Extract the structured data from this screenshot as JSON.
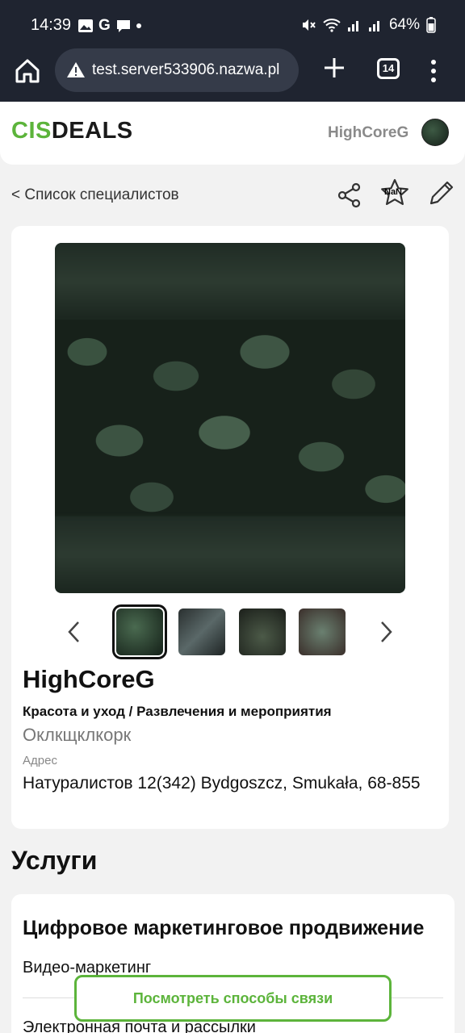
{
  "status_bar": {
    "time": "14:39",
    "battery": "64%"
  },
  "browser": {
    "url": "test.server533906.nazwa.pl",
    "tab_count": "14"
  },
  "header": {
    "logo_part1": "CIS",
    "logo_part2": "DEALS",
    "username": "HighCoreG"
  },
  "breadcrumb": {
    "back_label": "< Список специалистов",
    "rating_text": "NaN"
  },
  "profile": {
    "name": "HighCoreG",
    "categories": "Красота и уход / Развлечения и мероприятия",
    "description": "Оклкщклкорк",
    "address_label": "Адрес",
    "address": "Натуралистов 12(342) Bydgoszcz, Smukała, 68-855",
    "thumbnail_count": 4,
    "active_thumbnail": 1
  },
  "services": {
    "title": "Услуги",
    "group_title": "Цифровое маркетинговое продвижение",
    "items": [
      "Видео-маркетинг",
      "Электронная почта и рассылки"
    ]
  },
  "contact_button": {
    "label": "Посмотреть способы связи"
  },
  "colors": {
    "brand_green": "#5cb43b",
    "chrome_dark": "#1f2430"
  }
}
